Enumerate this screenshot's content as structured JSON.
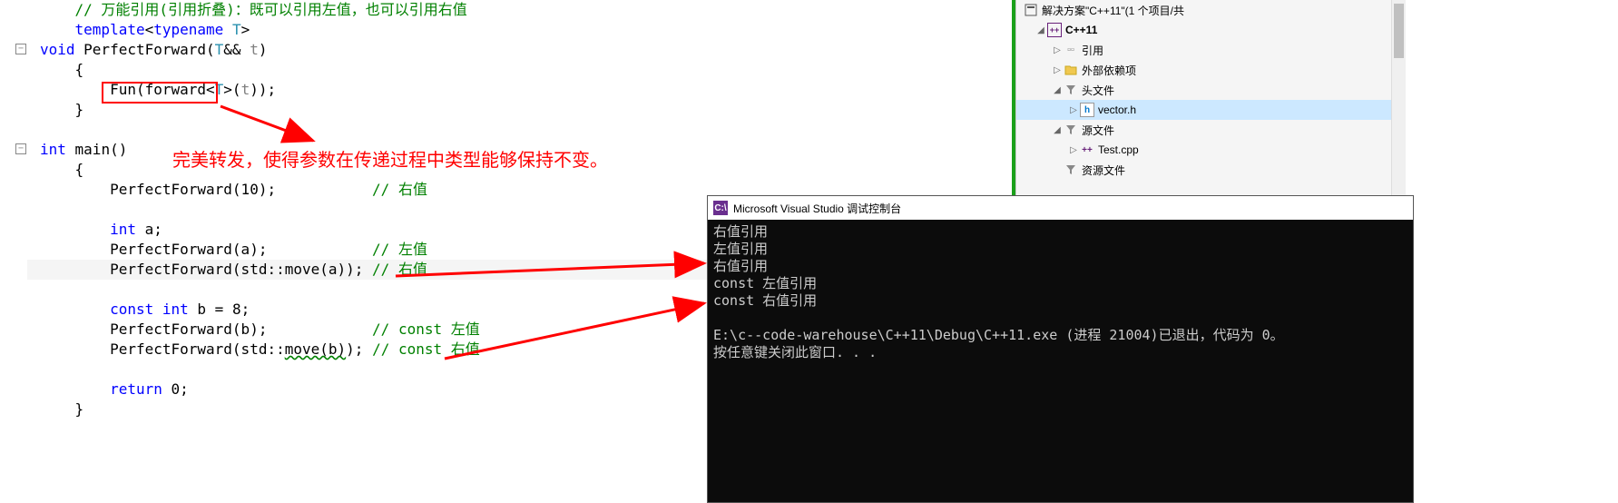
{
  "editor": {
    "lines": [
      {
        "indent": 1,
        "tokens": [
          {
            "t": "com",
            "v": "// 万能引用(引用折叠)：既可以引用左值，也可以引用右值"
          }
        ]
      },
      {
        "indent": 1,
        "tokens": [
          {
            "t": "kw",
            "v": "template"
          },
          {
            "t": "",
            "v": "<"
          },
          {
            "t": "kw",
            "v": "typename"
          },
          {
            "t": "",
            "v": " "
          },
          {
            "t": "cls",
            "v": "T"
          },
          {
            "t": "",
            "v": ">"
          }
        ]
      },
      {
        "fold": true,
        "indent": 0,
        "tokens": [
          {
            "t": "kw",
            "v": "void"
          },
          {
            "t": "",
            "v": " PerfectForward("
          },
          {
            "t": "cls",
            "v": "T"
          },
          {
            "t": "",
            "v": "&& "
          },
          {
            "t": "var",
            "v": "t"
          },
          {
            "t": "",
            "v": ")"
          }
        ]
      },
      {
        "indent": 1,
        "tokens": [
          {
            "t": "",
            "v": "{"
          }
        ]
      },
      {
        "indent": 2,
        "tokens": [
          {
            "t": "",
            "v": "Fun("
          },
          {
            "t": "",
            "v": "forward<"
          },
          {
            "t": "cls",
            "v": "T"
          },
          {
            "t": "",
            "v": ">("
          },
          {
            "t": "var",
            "v": "t"
          },
          {
            "t": "",
            "v": "));"
          }
        ]
      },
      {
        "indent": 1,
        "tokens": [
          {
            "t": "",
            "v": "}"
          }
        ]
      },
      {
        "indent": 0,
        "tokens": []
      },
      {
        "fold": true,
        "indent": 0,
        "tokens": [
          {
            "t": "kw",
            "v": "int"
          },
          {
            "t": "",
            "v": " main()"
          }
        ]
      },
      {
        "indent": 1,
        "tokens": [
          {
            "t": "",
            "v": "{"
          }
        ]
      },
      {
        "indent": 2,
        "tokens": [
          {
            "t": "",
            "v": "PerfectForward(10);           "
          },
          {
            "t": "com",
            "v": "// 右值"
          }
        ]
      },
      {
        "indent": 0,
        "tokens": []
      },
      {
        "indent": 2,
        "tokens": [
          {
            "t": "kw",
            "v": "int"
          },
          {
            "t": "",
            "v": " a;"
          }
        ]
      },
      {
        "indent": 2,
        "tokens": [
          {
            "t": "",
            "v": "PerfectForward(a);            "
          },
          {
            "t": "com",
            "v": "// 左值"
          }
        ]
      },
      {
        "indent": 2,
        "highlight": true,
        "tokens": [
          {
            "t": "",
            "v": "PerfectForward(std::move(a)); "
          },
          {
            "t": "com",
            "v": "// 右值"
          }
        ]
      },
      {
        "indent": 0,
        "tokens": []
      },
      {
        "indent": 2,
        "tokens": [
          {
            "t": "kw",
            "v": "const"
          },
          {
            "t": "",
            "v": " "
          },
          {
            "t": "kw",
            "v": "int"
          },
          {
            "t": "",
            "v": " b = 8;"
          }
        ]
      },
      {
        "indent": 2,
        "tokens": [
          {
            "t": "",
            "v": "PerfectForward(b);            "
          },
          {
            "t": "com",
            "v": "// const 左值"
          }
        ]
      },
      {
        "indent": 2,
        "tokens": [
          {
            "t": "",
            "v": "PerfectForward(std::"
          },
          {
            "t": "squiggle",
            "v": "move(b)"
          },
          {
            "t": "",
            "v": "); "
          },
          {
            "t": "com",
            "v": "// const 右值"
          }
        ]
      },
      {
        "indent": 0,
        "tokens": []
      },
      {
        "indent": 2,
        "tokens": [
          {
            "t": "kw",
            "v": "return"
          },
          {
            "t": "",
            "v": " 0;"
          }
        ]
      },
      {
        "indent": 1,
        "tokens": [
          {
            "t": "",
            "v": "}"
          }
        ]
      }
    ],
    "annotation_text": "完美转发，使得参数在传递过程中类型能够保持不变。",
    "fold_glyph": "−"
  },
  "console": {
    "title": "Microsoft Visual Studio 调试控制台",
    "icon_text": "C:\\",
    "lines": [
      "右值引用",
      "左值引用",
      "右值引用",
      "const 左值引用",
      "const 右值引用",
      "",
      "E:\\c--code-warehouse\\C++11\\Debug\\C++11.exe (进程 21004)已退出，代码为 0。",
      "按任意键关闭此窗口. . ."
    ]
  },
  "solution": {
    "header": "解决方案\"C++11\"(1 个项目/共",
    "items": [
      {
        "depth": 0,
        "glyph": "▲",
        "icon": "project",
        "label": "C++11",
        "bold": true
      },
      {
        "depth": 1,
        "glyph": "▷",
        "icon": "ref",
        "label": "引用"
      },
      {
        "depth": 1,
        "glyph": "▷",
        "icon": "folder",
        "label": "外部依赖项"
      },
      {
        "depth": 1,
        "glyph": "▲",
        "icon": "filter",
        "label": "头文件"
      },
      {
        "depth": 2,
        "glyph": "▷",
        "icon": "h",
        "label": "vector.h",
        "selected": true
      },
      {
        "depth": 1,
        "glyph": "▲",
        "icon": "filter",
        "label": "源文件"
      },
      {
        "depth": 2,
        "glyph": "▷",
        "icon": "cpp",
        "label": "Test.cpp"
      },
      {
        "depth": 1,
        "glyph": "",
        "icon": "filter",
        "label": "资源文件"
      }
    ]
  }
}
